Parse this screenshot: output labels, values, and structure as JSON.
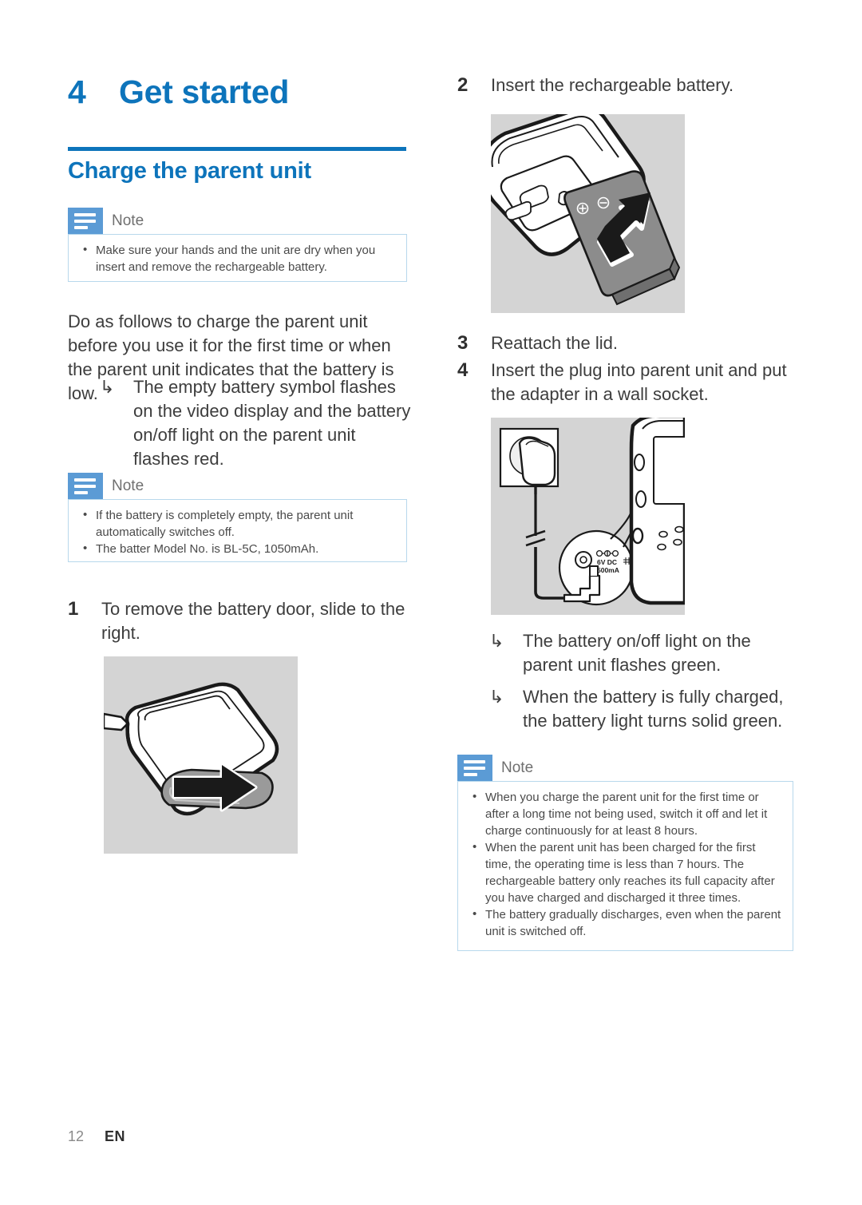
{
  "page": {
    "number": "12",
    "language": "EN"
  },
  "chapter": {
    "number": "4",
    "title": "Get started"
  },
  "section": {
    "title": "Charge the parent unit"
  },
  "notes": [
    {
      "label": "Note",
      "items": [
        "Make sure your hands and the unit are dry when you insert and remove the rechargeable battery."
      ]
    },
    {
      "label": "Note",
      "items": [
        "If the battery is completely empty, the parent unit automatically switches off.",
        "The batter Model No. is BL-5C, 1050mAh."
      ]
    },
    {
      "label": "Note",
      "items": [
        "When you charge the parent unit for the first time or after a long time not being used, switch it off and let it charge continuously for at least 8 hours.",
        "When the parent unit has been charged for the first time, the operating time is less than 7 hours. The rechargeable battery only reaches its full capacity after you have charged and discharged it three times.",
        "The battery gradually discharges, even when the parent unit is switched off."
      ]
    }
  ],
  "intro": {
    "paragraph": "Do as follows to charge the parent unit before you use it for the first time or when the parent unit indicates that the battery is low.",
    "results": [
      "The empty battery symbol flashes on the video display and the battery on/off light on the parent unit flashes red."
    ]
  },
  "steps": [
    {
      "number": "1",
      "text": "To remove the battery door, slide to the right."
    },
    {
      "number": "2",
      "text": "Insert the rechargeable battery."
    },
    {
      "number": "3",
      "text": "Reattach the lid."
    },
    {
      "number": "4",
      "text": "Insert the plug into parent unit and put the adapter in a wall socket."
    }
  ],
  "results_charging": [
    "The battery on/off light on the parent unit flashes green.",
    "When the battery is fully charged, the battery light turns solid green."
  ],
  "illustrations": [
    {
      "name": "battery-door-slide",
      "caption_step": "1"
    },
    {
      "name": "insert-battery",
      "caption_step": "2"
    },
    {
      "name": "plug-adapter-wall-socket",
      "caption_step": "4",
      "adapter_label_line1": "6V DC",
      "adapter_label_line2": "500mA"
    }
  ],
  "colors": {
    "accent_blue": "#0d74bb",
    "note_icon_blue": "#5b9bd5",
    "note_border": "#b8d8ec",
    "illustration_bg": "#d4d4d4",
    "body_text": "#3d3d3d"
  },
  "icons": {
    "note": "note-lines-icon",
    "result_arrow": "↳"
  }
}
